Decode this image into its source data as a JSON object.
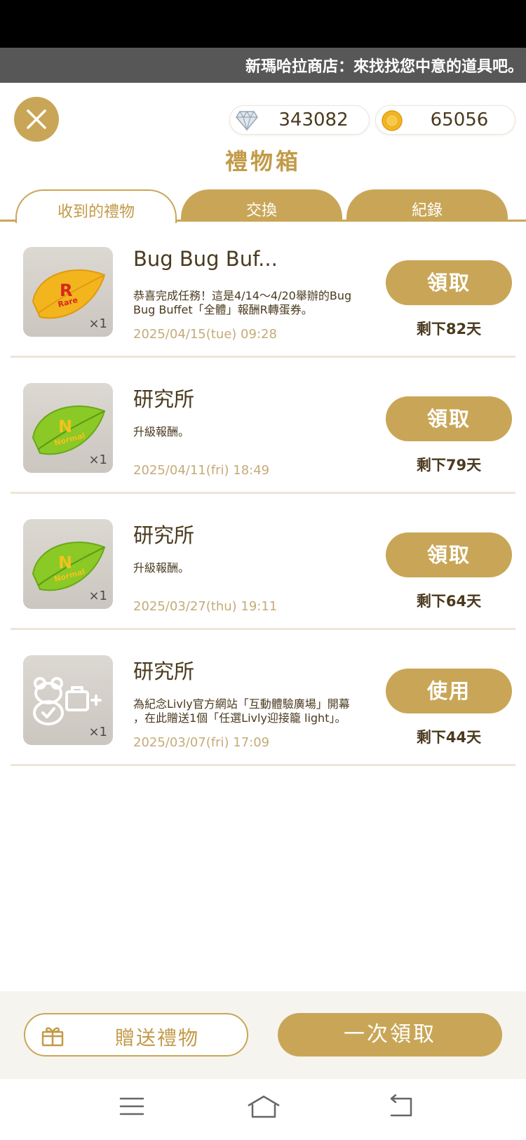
{
  "ticker": {
    "text": "新瑪哈拉商店：來找找您中意的道具吧。"
  },
  "header": {
    "gems": "343082",
    "coins": "65056",
    "title": "禮物箱"
  },
  "tabs": [
    {
      "label": "收到的禮物"
    },
    {
      "label": "交換"
    },
    {
      "label": "紀錄"
    }
  ],
  "gifts": [
    {
      "title": "Bug Bug Buf...",
      "desc_line1": "恭喜完成任務！這是4/14～4/20舉辦的Bug",
      "desc_line2": "Bug Buffet「全體」報酬R轉蛋券。",
      "date": "2025/04/15(tue) 09:28",
      "button": "領取",
      "remaining": "剩下82天",
      "qty": "×1",
      "icon": "rare-leaf-ticket-icon",
      "badge_letter": "R",
      "badge_word": "Rare"
    },
    {
      "title": "研究所",
      "desc_line1": "升級報酬。",
      "date": "2025/04/11(fri) 18:49",
      "button": "領取",
      "remaining": "剩下79天",
      "qty": "×1",
      "icon": "normal-leaf-ticket-icon",
      "badge_letter": "N",
      "badge_word": "Normal"
    },
    {
      "title": "研究所",
      "desc_line1": "升級報酬。",
      "date": "2025/03/27(thu) 19:11",
      "button": "領取",
      "remaining": "剩下64天",
      "qty": "×1",
      "icon": "normal-leaf-ticket-icon",
      "badge_letter": "N",
      "badge_word": "Normal"
    },
    {
      "title": "研究所",
      "desc_line1": "為紀念Livly官方網站「互動體驗廣場」開幕",
      "desc_line2": "，在此贈送1個「任選Livly迎接籠 light」。",
      "date": "2025/03/07(fri) 17:09",
      "button": "使用",
      "remaining": "剩下44天",
      "qty": "×1",
      "icon": "livly-cage-icon"
    }
  ],
  "footer": {
    "send_label": "贈送禮物",
    "claim_all_label": "一次領取"
  },
  "colors": {
    "accent": "#c9a657",
    "title_gold": "#c29a48",
    "date_text": "#c5ab78"
  }
}
